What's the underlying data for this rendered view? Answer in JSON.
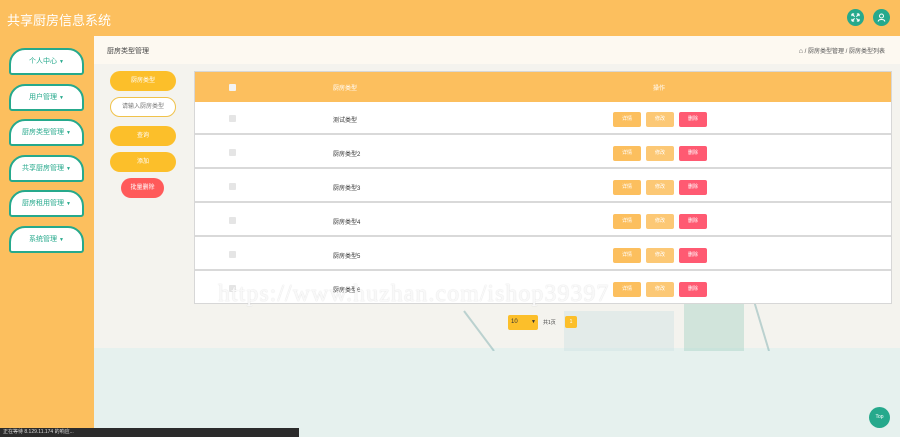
{
  "header": {
    "app_title": "共享厨房信息系统",
    "fullscreen_icon": "expand-icon",
    "user_icon": "user-icon"
  },
  "sidebar": {
    "items": [
      {
        "label": "个人中心"
      },
      {
        "label": "用户管理"
      },
      {
        "label": "厨房类型管理"
      },
      {
        "label": "共享厨房管理"
      },
      {
        "label": "厨房租用管理"
      },
      {
        "label": "系统管理"
      }
    ],
    "caret": "▼"
  },
  "breadcrumb": {
    "page_title": "厨房类型管理",
    "home_icon": "⌂",
    "path": "/ 厨房类型管理 / 厨房类型列表"
  },
  "filters": {
    "field_label": "厨房类型",
    "input_placeholder": "请输入厨房类型",
    "search_label": "查询",
    "add_label": "添加",
    "bulk_delete_label": "批量删除"
  },
  "table": {
    "columns": [
      "厨房类型",
      "操作"
    ],
    "rows": [
      {
        "name": "测试类型"
      },
      {
        "name": "厨房类型2"
      },
      {
        "name": "厨房类型3"
      },
      {
        "name": "厨房类型4"
      },
      {
        "name": "厨房类型5"
      },
      {
        "name": "厨房类型6"
      }
    ],
    "actions": {
      "detail": "详情",
      "edit": "修改",
      "delete": "删除"
    }
  },
  "pagination": {
    "page_size": "10",
    "total_pages_text": "共1页",
    "current_page": "1"
  },
  "watermark": "https://www.huzhan.com/ishop39397",
  "top_button": "Top",
  "status_bar": "正在等待 8.129.11.174 的响应...",
  "colors": {
    "accent": "#fcbf5e",
    "teal": "#26a98c",
    "danger": "#ff5a72"
  }
}
